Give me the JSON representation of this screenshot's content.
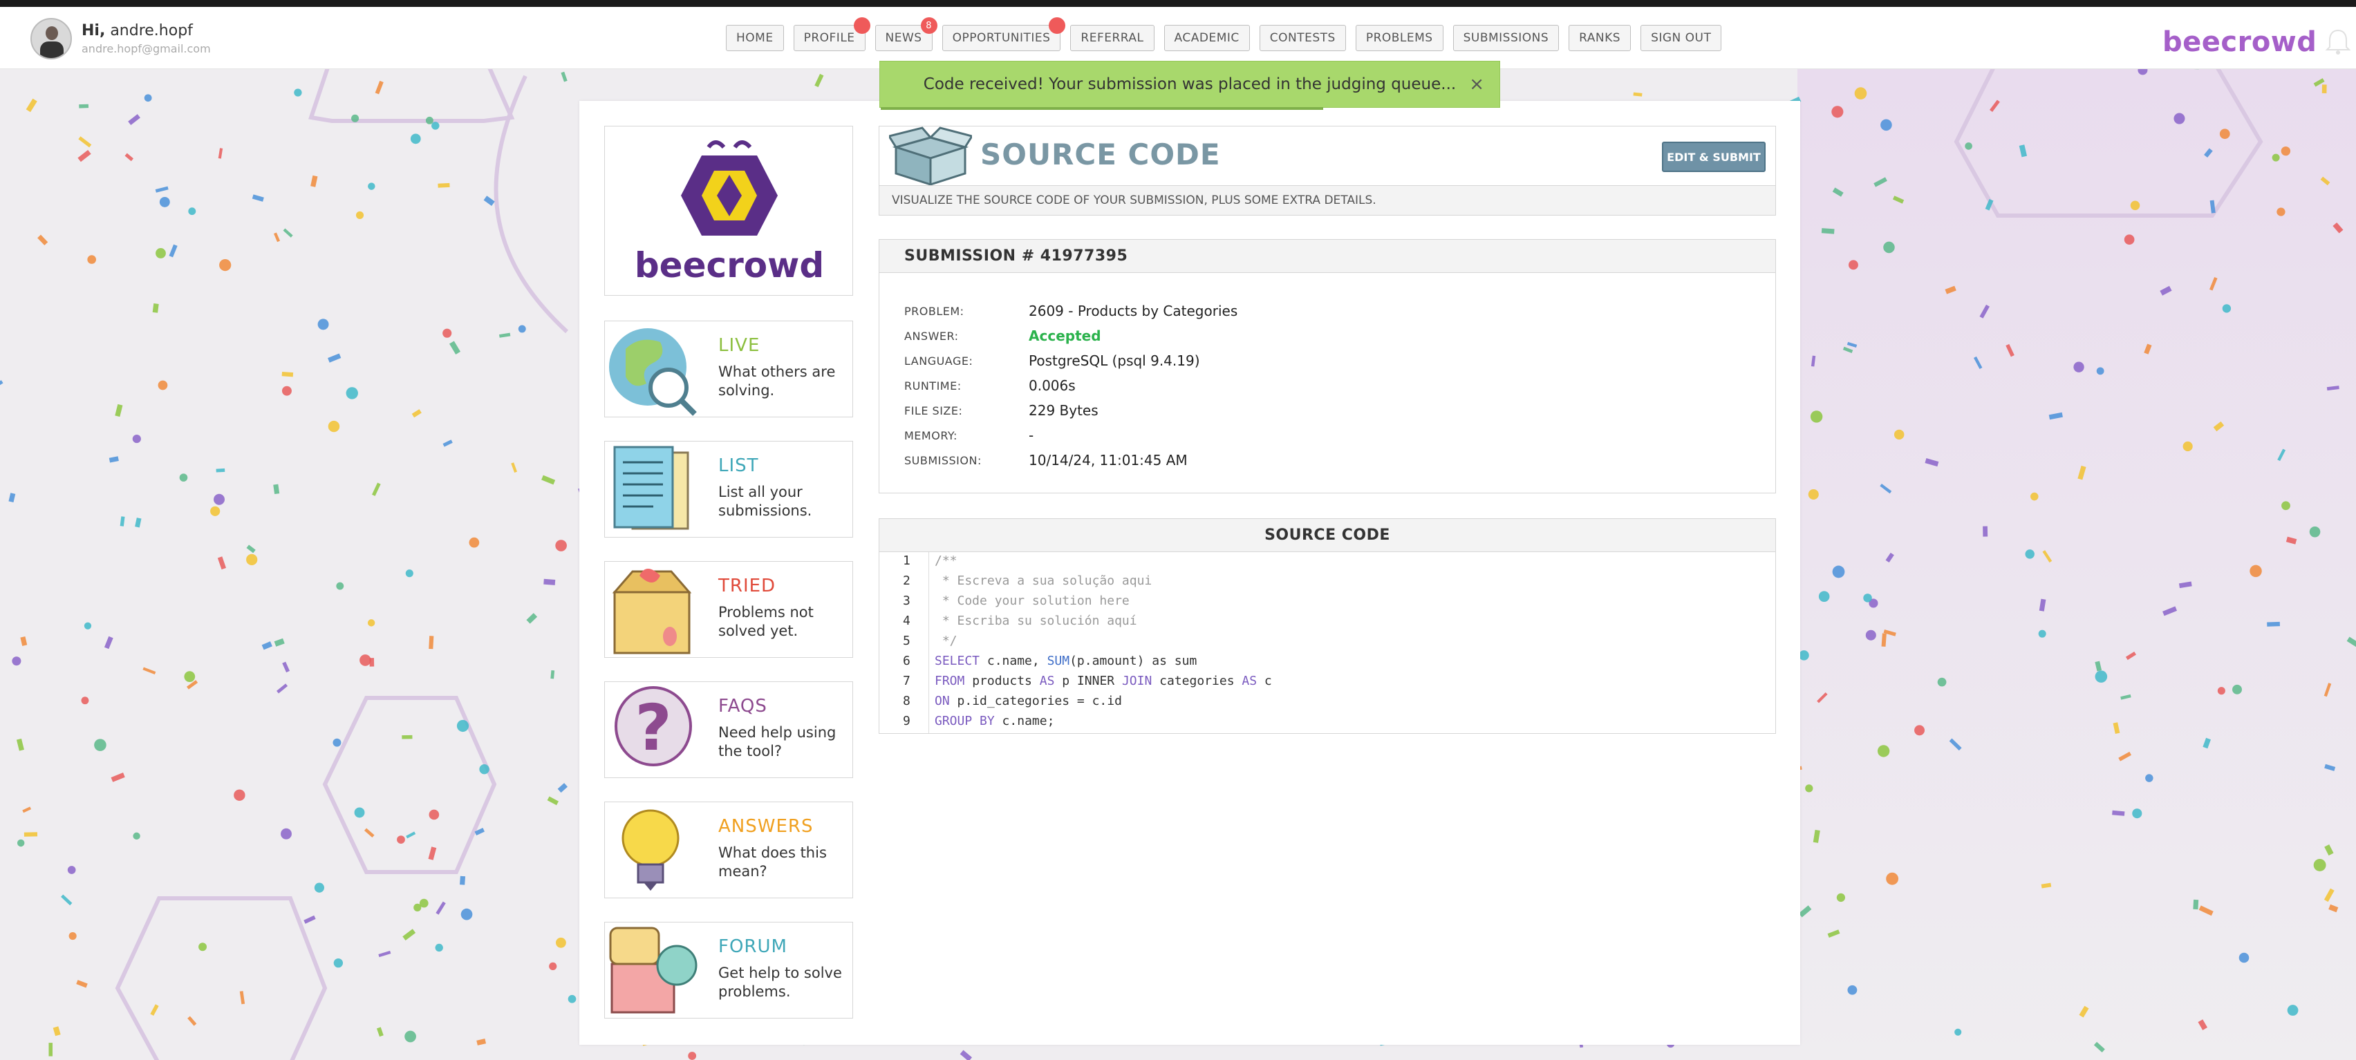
{
  "header": {
    "greeting_prefix": "Hi,",
    "username": "andre.hopf",
    "email": "andre.hopf@gmail.com",
    "brand": "beecrowd"
  },
  "nav": [
    {
      "label": "HOME",
      "badge": ""
    },
    {
      "label": "PROFILE",
      "badge": ""
    },
    {
      "label": "NEWS",
      "badge": "8"
    },
    {
      "label": "OPPORTUNITIES",
      "badge": ""
    },
    {
      "label": "REFERRAL",
      "badge": ""
    },
    {
      "label": "ACADEMIC",
      "badge": ""
    },
    {
      "label": "CONTESTS",
      "badge": ""
    },
    {
      "label": "PROBLEMS",
      "badge": ""
    },
    {
      "label": "SUBMISSIONS",
      "badge": ""
    },
    {
      "label": "RANKS",
      "badge": ""
    },
    {
      "label": "SIGN OUT",
      "badge": ""
    }
  ],
  "toast": {
    "message": "Code received! Your submission was placed in the judging queue...",
    "close": "×"
  },
  "sidebar": {
    "logo_text": "beecrowd",
    "items": [
      {
        "title": "LIVE",
        "desc": "What others are solving.",
        "color": "#8cbf3f"
      },
      {
        "title": "LIST",
        "desc": "List all your submissions.",
        "color": "#3fa7b8"
      },
      {
        "title": "TRIED",
        "desc": "Problems not solved yet.",
        "color": "#e04a3a"
      },
      {
        "title": "FAQS",
        "desc": "Need help using the tool?",
        "color": "#8d4a8f"
      },
      {
        "title": "ANSWERS",
        "desc": "What does this mean?",
        "color": "#f0a020"
      },
      {
        "title": "FORUM",
        "desc": "Get help to solve problems.",
        "color": "#3fa7b8"
      }
    ]
  },
  "source_header": {
    "title": "SOURCE CODE",
    "edit_button": "EDIT & SUBMIT",
    "subtitle": "VISUALIZE THE SOURCE CODE OF YOUR SUBMISSION, PLUS SOME EXTRA DETAILS."
  },
  "submission": {
    "heading": "SUBMISSION # 41977395",
    "rows": [
      {
        "label": "PROBLEM:",
        "value": "2609 - Products by Categories"
      },
      {
        "label": "ANSWER:",
        "value": "Accepted"
      },
      {
        "label": "LANGUAGE:",
        "value": "PostgreSQL (psql 9.4.19)"
      },
      {
        "label": "RUNTIME:",
        "value": "0.006s"
      },
      {
        "label": "FILE SIZE:",
        "value": "229 Bytes"
      },
      {
        "label": "MEMORY:",
        "value": "-"
      },
      {
        "label": "SUBMISSION:",
        "value": "10/14/24, 11:01:45 AM"
      }
    ]
  },
  "code": {
    "heading": "SOURCE CODE",
    "line_numbers": [
      "1",
      "2",
      "3",
      "4",
      "5",
      "6",
      "7",
      "8",
      "9"
    ],
    "lines": [
      "/**",
      " * Escreva a sua solução aqui",
      " * Code your solution here",
      " * Escriba su solución aquí",
      " */",
      "SELECT c.name, SUM(p.amount) as sum",
      "FROM products AS p INNER JOIN categories AS c",
      "ON p.id_categories = c.id",
      "GROUP BY c.name;"
    ]
  }
}
